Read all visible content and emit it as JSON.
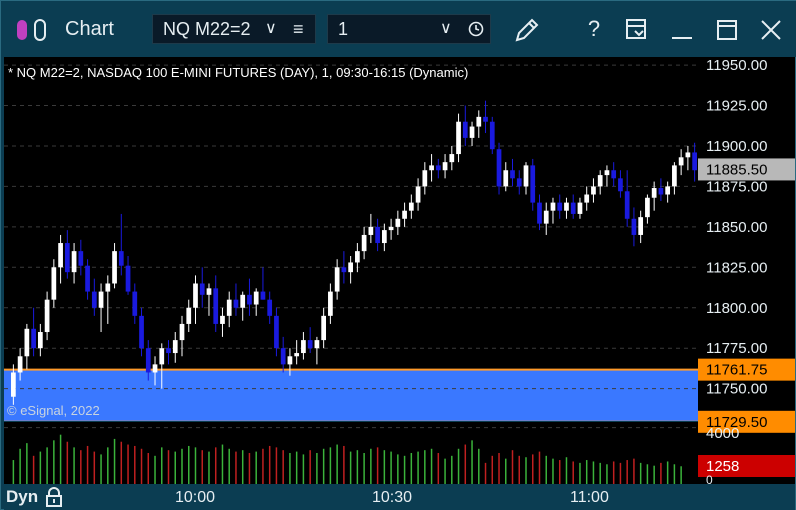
{
  "window": {
    "title": "Chart",
    "symbol": "NQ M22=2",
    "interval": "1"
  },
  "chart": {
    "legend": "* NQ M22=2, NASDAQ 100 E-MINI FUTURES (DAY), 1, 09:30-16:15 (Dynamic)",
    "copyright": "© eSignal, 2022",
    "mode_label": "Dyn",
    "price_ticks": [
      "11950.00",
      "11925.00",
      "11900.00",
      "11875.00",
      "11850.00",
      "11825.00",
      "11800.00",
      "11775.00",
      "11750.00"
    ],
    "last_price": "11885.50",
    "zone_top": "11761.75",
    "zone_bottom": "11729.50",
    "volume_tick": "4000",
    "volume_last": "1258",
    "volume_zero": "0",
    "time_ticks": [
      "10:00",
      "10:30",
      "11:00"
    ],
    "colors": {
      "up": "#ffffff",
      "down": "#1a1adf",
      "zone": "#3a78ff",
      "zone_border": "#ff9a2a",
      "vol_up": "#3bb33b",
      "vol_down": "#c02020",
      "last_price_bg": "#b8b8b8",
      "zone_label_bg": "#ff8c00",
      "volume_last_bg": "#cc0000"
    }
  },
  "chart_data": {
    "type": "candlestick",
    "ylim": [
      11730,
      11955
    ],
    "x_start": "09:30",
    "interval_minutes": 1,
    "zone": [
      11729.5,
      11761.75
    ],
    "candles": [
      [
        11745,
        11765,
        11740,
        11760
      ],
      [
        11760,
        11775,
        11755,
        11770
      ],
      [
        11770,
        11790,
        11762,
        11787
      ],
      [
        11787,
        11800,
        11770,
        11775
      ],
      [
        11775,
        11790,
        11770,
        11785
      ],
      [
        11785,
        11810,
        11780,
        11805
      ],
      [
        11805,
        11830,
        11800,
        11825
      ],
      [
        11825,
        11845,
        11815,
        11840
      ],
      [
        11840,
        11848,
        11818,
        11822
      ],
      [
        11822,
        11840,
        11815,
        11835
      ],
      [
        11835,
        11842,
        11820,
        11826
      ],
      [
        11826,
        11830,
        11805,
        11810
      ],
      [
        11810,
        11818,
        11795,
        11800
      ],
      [
        11800,
        11815,
        11785,
        11810
      ],
      [
        11810,
        11820,
        11790,
        11815
      ],
      [
        11815,
        11840,
        11812,
        11835
      ],
      [
        11835,
        11858,
        11820,
        11826
      ],
      [
        11826,
        11832,
        11808,
        11810
      ],
      [
        11810,
        11815,
        11790,
        11795
      ],
      [
        11795,
        11800,
        11770,
        11775
      ],
      [
        11775,
        11780,
        11755,
        11760
      ],
      [
        11760,
        11770,
        11752,
        11765
      ],
      [
        11765,
        11778,
        11750,
        11775
      ],
      [
        11775,
        11780,
        11765,
        11772
      ],
      [
        11772,
        11785,
        11766,
        11780
      ],
      [
        11780,
        11795,
        11770,
        11790
      ],
      [
        11790,
        11805,
        11785,
        11800
      ],
      [
        11800,
        11820,
        11790,
        11815
      ],
      [
        11815,
        11825,
        11800,
        11808
      ],
      [
        11808,
        11815,
        11795,
        11812
      ],
      [
        11812,
        11820,
        11785,
        11790
      ],
      [
        11790,
        11800,
        11782,
        11795
      ],
      [
        11795,
        11810,
        11788,
        11805
      ],
      [
        11805,
        11815,
        11795,
        11800
      ],
      [
        11800,
        11810,
        11792,
        11808
      ],
      [
        11808,
        11818,
        11795,
        11802
      ],
      [
        11802,
        11812,
        11795,
        11810
      ],
      [
        11810,
        11825,
        11805,
        11805
      ],
      [
        11805,
        11810,
        11790,
        11795
      ],
      [
        11795,
        11800,
        11770,
        11775
      ],
      [
        11775,
        11782,
        11760,
        11765
      ],
      [
        11765,
        11775,
        11758,
        11770
      ],
      [
        11770,
        11780,
        11765,
        11772
      ],
      [
        11772,
        11785,
        11768,
        11780
      ],
      [
        11780,
        11788,
        11772,
        11775
      ],
      [
        11775,
        11782,
        11765,
        11780
      ],
      [
        11780,
        11800,
        11775,
        11795
      ],
      [
        11795,
        11815,
        11790,
        11810
      ],
      [
        11810,
        11830,
        11805,
        11825
      ],
      [
        11825,
        11835,
        11815,
        11822
      ],
      [
        11822,
        11832,
        11815,
        11828
      ],
      [
        11828,
        11840,
        11822,
        11835
      ],
      [
        11835,
        11850,
        11830,
        11845
      ],
      [
        11845,
        11858,
        11840,
        11850
      ],
      [
        11850,
        11855,
        11835,
        11840
      ],
      [
        11840,
        11852,
        11835,
        11848
      ],
      [
        11848,
        11855,
        11842,
        11850
      ],
      [
        11850,
        11860,
        11845,
        11855
      ],
      [
        11855,
        11865,
        11850,
        11860
      ],
      [
        11860,
        11870,
        11855,
        11865
      ],
      [
        11865,
        11880,
        11860,
        11875
      ],
      [
        11875,
        11890,
        11870,
        11885
      ],
      [
        11885,
        11895,
        11878,
        11888
      ],
      [
        11888,
        11892,
        11880,
        11885
      ],
      [
        11885,
        11895,
        11880,
        11890
      ],
      [
        11890,
        11900,
        11885,
        11895
      ],
      [
        11895,
        11920,
        11890,
        11915
      ],
      [
        11915,
        11925,
        11900,
        11905
      ],
      [
        11905,
        11915,
        11900,
        11912
      ],
      [
        11912,
        11922,
        11905,
        11918
      ],
      [
        11918,
        11928,
        11908,
        11915
      ],
      [
        11915,
        11918,
        11895,
        11898
      ],
      [
        11898,
        11902,
        11870,
        11875
      ],
      [
        11875,
        11890,
        11872,
        11885
      ],
      [
        11885,
        11892,
        11875,
        11880
      ],
      [
        11880,
        11885,
        11870,
        11875
      ],
      [
        11875,
        11890,
        11870,
        11888
      ],
      [
        11888,
        11892,
        11860,
        11865
      ],
      [
        11865,
        11870,
        11848,
        11852
      ],
      [
        11852,
        11865,
        11845,
        11860
      ],
      [
        11860,
        11868,
        11852,
        11865
      ],
      [
        11865,
        11870,
        11855,
        11860
      ],
      [
        11860,
        11868,
        11855,
        11865
      ],
      [
        11865,
        11870,
        11855,
        11858
      ],
      [
        11858,
        11868,
        11855,
        11865
      ],
      [
        11865,
        11875,
        11860,
        11870
      ],
      [
        11870,
        11880,
        11865,
        11875
      ],
      [
        11875,
        11885,
        11870,
        11882
      ],
      [
        11882,
        11888,
        11875,
        11885
      ],
      [
        11885,
        11890,
        11875,
        11880
      ],
      [
        11880,
        11885,
        11868,
        11872
      ],
      [
        11872,
        11885,
        11850,
        11855
      ],
      [
        11855,
        11862,
        11838,
        11845
      ],
      [
        11845,
        11860,
        11840,
        11856
      ],
      [
        11856,
        11870,
        11852,
        11868
      ],
      [
        11868,
        11878,
        11860,
        11874
      ],
      [
        11874,
        11880,
        11866,
        11870
      ],
      [
        11870,
        11878,
        11865,
        11875
      ],
      [
        11875,
        11890,
        11870,
        11888
      ],
      [
        11888,
        11898,
        11882,
        11893
      ],
      [
        11893,
        11900,
        11885,
        11896
      ],
      [
        11896,
        11902,
        11878,
        11885
      ]
    ],
    "volume": [
      1700,
      2500,
      2900,
      2000,
      2300,
      2600,
      3100,
      3500,
      3000,
      2600,
      2400,
      2700,
      2300,
      2100,
      2600,
      3200,
      3000,
      2800,
      2700,
      2500,
      2200,
      2000,
      2600,
      2400,
      2300,
      2500,
      2700,
      2600,
      2400,
      2300,
      2600,
      2800,
      2500,
      2300,
      2400,
      2200,
      2300,
      2500,
      2700,
      2600,
      2400,
      2200,
      2300,
      2100,
      2400,
      2200,
      2500,
      2600,
      2800,
      2700,
      2300,
      2400,
      2200,
      2500,
      2600,
      2400,
      2300,
      2100,
      2000,
      2200,
      2300,
      2400,
      2500,
      2200,
      1800,
      2000,
      2500,
      2800,
      3100,
      2500,
      1500,
      2000,
      2200,
      1800,
      2400,
      2000,
      1900,
      2100,
      2300,
      2000,
      1800,
      1700,
      1900,
      1600,
      1500,
      1700,
      1600,
      1500,
      1400,
      1600,
      1500,
      1700,
      1800,
      1500,
      1400,
      1300,
      1500,
      1600,
      1400,
      1258
    ]
  }
}
